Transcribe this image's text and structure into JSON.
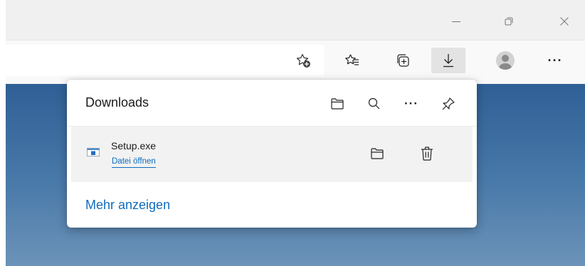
{
  "window": {
    "minimize_icon": "minimize-icon",
    "restore_icon": "restore-icon",
    "close_icon": "close-icon"
  },
  "toolbar": {
    "icons": [
      "add-favorite-icon",
      "favorites-icon",
      "collections-icon",
      "download-icon",
      "profile-avatar",
      "more-icon"
    ],
    "more_label": "···"
  },
  "downloads": {
    "title": "Downloads",
    "header_more_label": "···",
    "items": [
      {
        "file_name": "Setup.exe",
        "action_label": "Datei öffnen"
      }
    ],
    "show_more_label": "Mehr anzeigen"
  },
  "colors": {
    "accent": "#0f6cbd",
    "titlebar": "#f0f0f0",
    "toolbar": "#f9f9f9",
    "page_background_top": "#2f5f95",
    "page_background_bottom": "#6c93b8"
  }
}
